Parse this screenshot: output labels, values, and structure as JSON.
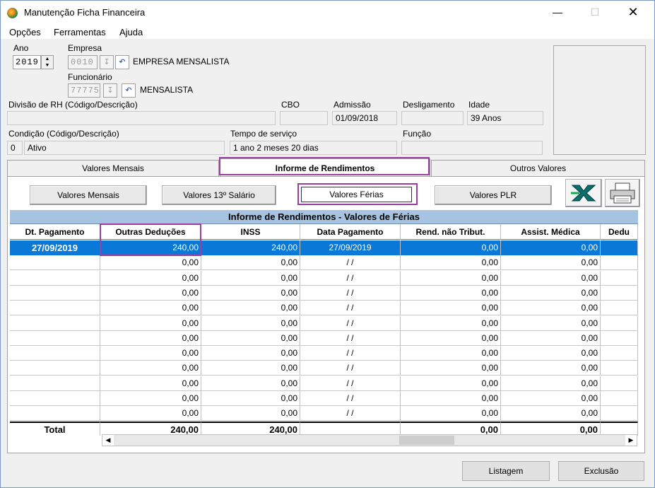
{
  "window": {
    "title": "Manutenção Ficha Financeira"
  },
  "menu": [
    "Opções",
    "Ferramentas",
    "Ajuda"
  ],
  "header": {
    "ano_label": "Ano",
    "ano_value": "2019",
    "empresa_label": "Empresa",
    "empresa_code": "0010",
    "empresa_name": "EMPRESA MENSALISTA",
    "funcionario_label": "Funcionário",
    "funcionario_code": "77775",
    "funcionario_name": "MENSALISTA",
    "divisao_label": "Divisão de RH (Código/Descrição)",
    "cbo_label": "CBO",
    "admissao_label": "Admissão",
    "admissao_value": "01/09/2018",
    "desligamento_label": "Desligamento",
    "idade_label": "Idade",
    "idade_value": "39 Anos",
    "condicao_label": "Condição (Código/Descrição)",
    "condicao_code": "0",
    "condicao_desc": "Ativo",
    "tempo_label": "Tempo de serviço",
    "tempo_value": "1 ano 2 meses 20 dias",
    "funcao_label": "Função"
  },
  "tabs": [
    "Valores Mensais",
    "Informe de Rendimentos",
    "Outros Valores"
  ],
  "subbuttons": [
    "Valores Mensais",
    "Valores 13º Salário",
    "Valores Férias",
    "Valores PLR"
  ],
  "grid": {
    "title": "Informe de Rendimentos - Valores de Férias",
    "columns": [
      "Dt. Pagamento",
      "Outras Deduções",
      "INSS",
      "Data Pagamento",
      "Rend. não Tribut.",
      "Assist. Médica",
      "Dedu"
    ],
    "rows": [
      [
        "27/09/2019",
        "240,00",
        "240,00",
        "27/09/2019",
        "0,00",
        "0,00"
      ],
      [
        "",
        "0,00",
        "0,00",
        "/ /",
        "0,00",
        "0,00"
      ],
      [
        "",
        "0,00",
        "0,00",
        "/ /",
        "0,00",
        "0,00"
      ],
      [
        "",
        "0,00",
        "0,00",
        "/ /",
        "0,00",
        "0,00"
      ],
      [
        "",
        "0,00",
        "0,00",
        "/ /",
        "0,00",
        "0,00"
      ],
      [
        "",
        "0,00",
        "0,00",
        "/ /",
        "0,00",
        "0,00"
      ],
      [
        "",
        "0,00",
        "0,00",
        "/ /",
        "0,00",
        "0,00"
      ],
      [
        "",
        "0,00",
        "0,00",
        "/ /",
        "0,00",
        "0,00"
      ],
      [
        "",
        "0,00",
        "0,00",
        "/ /",
        "0,00",
        "0,00"
      ],
      [
        "",
        "0,00",
        "0,00",
        "/ /",
        "0,00",
        "0,00"
      ],
      [
        "",
        "0,00",
        "0,00",
        "/ /",
        "0,00",
        "0,00"
      ],
      [
        "",
        "0,00",
        "0,00",
        "/ /",
        "0,00",
        "0,00"
      ]
    ],
    "totals": [
      "Total",
      "240,00",
      "240,00",
      "",
      "0,00",
      "0,00"
    ]
  },
  "footer": {
    "listagem": "Listagem",
    "exclusao": "Exclusão"
  },
  "colors": {
    "selected_row": "#0a78d7",
    "grid_header": "#a6c4e2",
    "highlight": "#9b3da2"
  }
}
